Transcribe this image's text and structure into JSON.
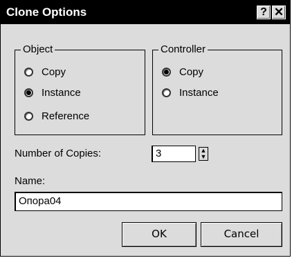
{
  "window": {
    "title": "Clone Options",
    "help_label": "?",
    "close_label": "✕"
  },
  "object_group": {
    "label": "Object",
    "options": [
      {
        "label": "Copy",
        "checked": false
      },
      {
        "label": "Instance",
        "checked": true
      },
      {
        "label": "Reference",
        "checked": false
      }
    ]
  },
  "controller_group": {
    "label": "Controller",
    "options": [
      {
        "label": "Copy",
        "checked": true
      },
      {
        "label": "Instance",
        "checked": false
      }
    ]
  },
  "copies": {
    "label": "Number of Copies:",
    "value": "3",
    "spin_up": "▲",
    "spin_down": "▼"
  },
  "name": {
    "label": "Name:",
    "value": "Опора04"
  },
  "buttons": {
    "ok": "OK",
    "cancel": "Cancel"
  }
}
